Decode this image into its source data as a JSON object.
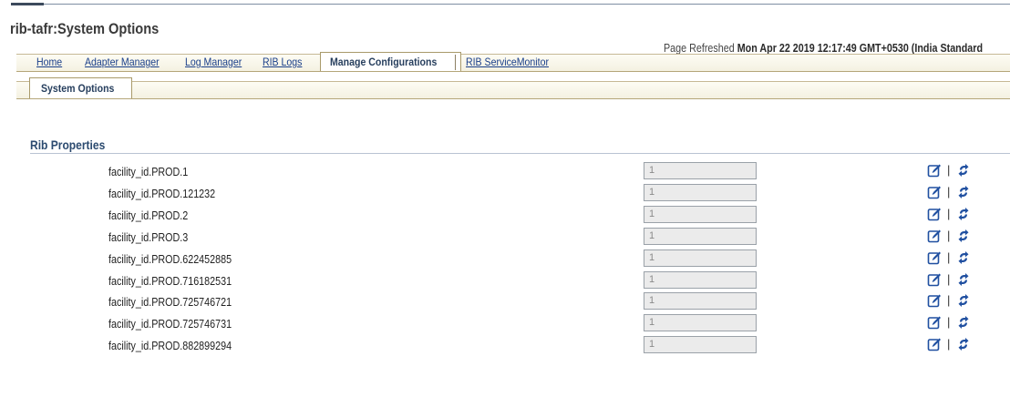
{
  "page": {
    "title": "rib-tafr:System Options",
    "refreshed_label": "Page Refreshed",
    "refreshed_value": "Mon Apr 22 2019 12:17:49 GMT+0530 (India Standard"
  },
  "nav_tabs": [
    {
      "label": "Home"
    },
    {
      "label": "Adapter Manager"
    },
    {
      "label": "Log Manager"
    },
    {
      "label": "RIB Logs"
    },
    {
      "label": "Manage Configurations",
      "active": true
    },
    {
      "label": "RIB ServiceMonitor"
    }
  ],
  "sub_tabs": [
    {
      "label": "System Options"
    }
  ],
  "section": {
    "title": "Rib Properties"
  },
  "properties": [
    {
      "name": "facility_id.PROD.1",
      "value": "1"
    },
    {
      "name": "facility_id.PROD.121232",
      "value": "1"
    },
    {
      "name": "facility_id.PROD.2",
      "value": "1"
    },
    {
      "name": "facility_id.PROD.3",
      "value": "1"
    },
    {
      "name": "facility_id.PROD.622452885",
      "value": "1"
    },
    {
      "name": "facility_id.PROD.716182531",
      "value": "1"
    },
    {
      "name": "facility_id.PROD.725746721",
      "value": "1"
    },
    {
      "name": "facility_id.PROD.725746731",
      "value": "1"
    },
    {
      "name": "facility_id.PROD.882899294",
      "value": "1"
    }
  ],
  "action_separator": "|",
  "icons": {
    "edit": "edit-pencil-icon",
    "reset": "refresh-arrows-icon"
  },
  "colors": {
    "link": "#1a3f8a",
    "header": "#2b4a6f",
    "tab_border": "#a99a6a",
    "icon_blue": "#1f4fa0"
  }
}
